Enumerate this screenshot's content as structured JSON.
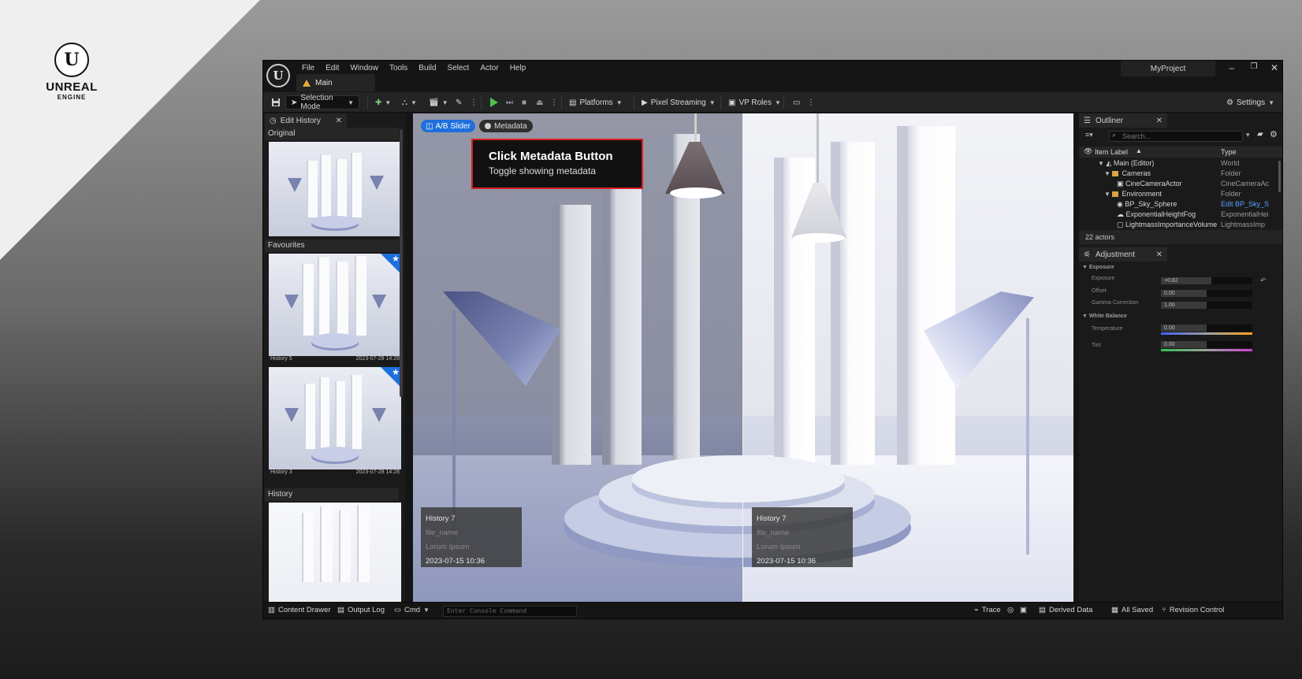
{
  "branding": {
    "wordmark_line1": "UNREAL",
    "wordmark_line2": "ENGINE",
    "logo_glyph": "U"
  },
  "window": {
    "project_name": "MyProject",
    "menu": [
      "File",
      "Edit",
      "Window",
      "Tools",
      "Build",
      "Select",
      "Actor",
      "Help"
    ],
    "level_tab": "Main",
    "controls": {
      "minimize": "–",
      "restore": "❐",
      "close": "✕"
    }
  },
  "toolbar": {
    "selection_mode": "Selection Mode",
    "platforms": "Platforms",
    "pixel_streaming": "Pixel Streaming",
    "vp_roles": "VP Roles",
    "settings": "Settings"
  },
  "edit_history": {
    "tab_label": "Edit History",
    "sections": {
      "original": "Original",
      "favourites": "Favourites",
      "history": "History"
    },
    "favourites": [
      {
        "name": "History 5",
        "date": "2023-07-28 14:28"
      },
      {
        "name": "History 3",
        "date": "2023-07-28 14:28"
      }
    ]
  },
  "viewport": {
    "ab_slider_label": "A/B Slider",
    "metadata_label": "Metadata",
    "tooltip": {
      "title": "Click Metadata Button",
      "subtitle": "Toggle showing metadata"
    },
    "left_meta": {
      "title": "History 7",
      "file": "file_name",
      "desc": "Lorum Ipsum",
      "date": "2023-07-15 10:36"
    },
    "right_meta": {
      "title": "History 7",
      "file": "file_name",
      "desc": "Lorum Ipsum",
      "date": "2023-07-15 10:36"
    }
  },
  "outliner": {
    "tab_label": "Outliner",
    "search_placeholder": "Search...",
    "col_label": "Item Label",
    "col_type": "Type",
    "rows": [
      {
        "label": "Main (Editor)",
        "type": "World"
      },
      {
        "label": "Cameras",
        "type": "Folder"
      },
      {
        "label": "CineCameraActor",
        "type": "CineCameraAc"
      },
      {
        "label": "Environment",
        "type": "Folder"
      },
      {
        "label": "BP_Sky_Sphere",
        "type": "Edit BP_Sky_S"
      },
      {
        "label": "ExponentialHeightFog",
        "type": "ExponentialHei"
      },
      {
        "label": "LightmassImportanceVolume",
        "type": "LightmassImp"
      }
    ],
    "actor_count": "22 actors"
  },
  "adjustment": {
    "tab_label": "Adjustment",
    "exposure_section": "Exposure",
    "white_balance_section": "White Balance",
    "rows": {
      "exposure": {
        "label": "Exposure",
        "value": "+0.82",
        "level": 0.55
      },
      "offset": {
        "label": "Offset",
        "value": "0.00",
        "level": 0.5
      },
      "gamma": {
        "label": "Gamma Correction",
        "value": "1.00",
        "level": 0.5
      },
      "temperature": {
        "label": "Temperature",
        "value": "0.00",
        "level": 0.5
      },
      "tint": {
        "label": "Tint",
        "value": "0.00",
        "level": 0.5
      }
    }
  },
  "statusbar": {
    "content_drawer": "Content Drawer",
    "output_log": "Output Log",
    "cmd": "Cmd",
    "console_placeholder": "Enter Console Command",
    "trace": "Trace",
    "derived_data": "Derived Data",
    "all_saved": "All Saved",
    "revision_control": "Revision Control"
  },
  "colors": {
    "accent_blue": "#1e6fdc",
    "tooltip_border": "#d82020",
    "play_green": "#4fbf4f",
    "level_icon": "#e6a83a"
  }
}
